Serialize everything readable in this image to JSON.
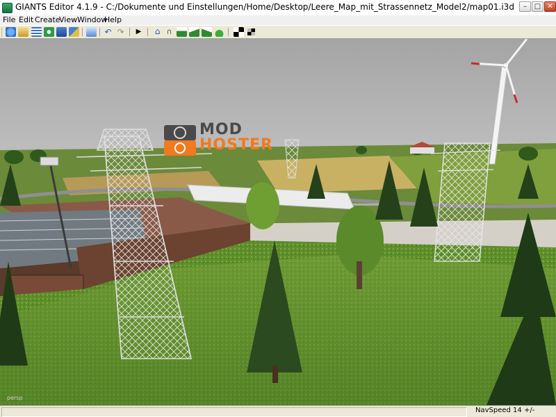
{
  "window": {
    "title": "GIANTS Editor 4.1.9 - C:/Dokumente und Einstellungen/Home/Desktop/Leere_Map_mit_Strassennetz_Model2/map01.i3d",
    "controls": [
      "minimize",
      "maximize",
      "close"
    ]
  },
  "menu": [
    "File",
    "Edit",
    "Create",
    "View",
    "Window",
    "Help"
  ],
  "toolbar": {
    "icons": [
      "new-file-icon",
      "open-file-icon",
      "list-icon",
      "refresh-icon",
      "save-icon",
      "save-all-icon",
      "export-icon",
      "undo-icon",
      "redo-icon",
      "play-icon",
      "home-icon",
      "magnet-icon",
      "terrain-paint-icon",
      "terrain-sculpt-icon",
      "terrain-smooth-icon",
      "foliage-icon",
      "checker-icon",
      "checker-settings-icon"
    ]
  },
  "viewport": {
    "watermark_top": "MOD",
    "watermark_bottom": "HOSTER",
    "persp_label": "persp",
    "colors": {
      "sky": "#a6a6a6",
      "grass": "#5c8a2a",
      "accent": "#f07a1f"
    }
  },
  "status": {
    "navspeed": "NavSpeed 14 +/-"
  }
}
